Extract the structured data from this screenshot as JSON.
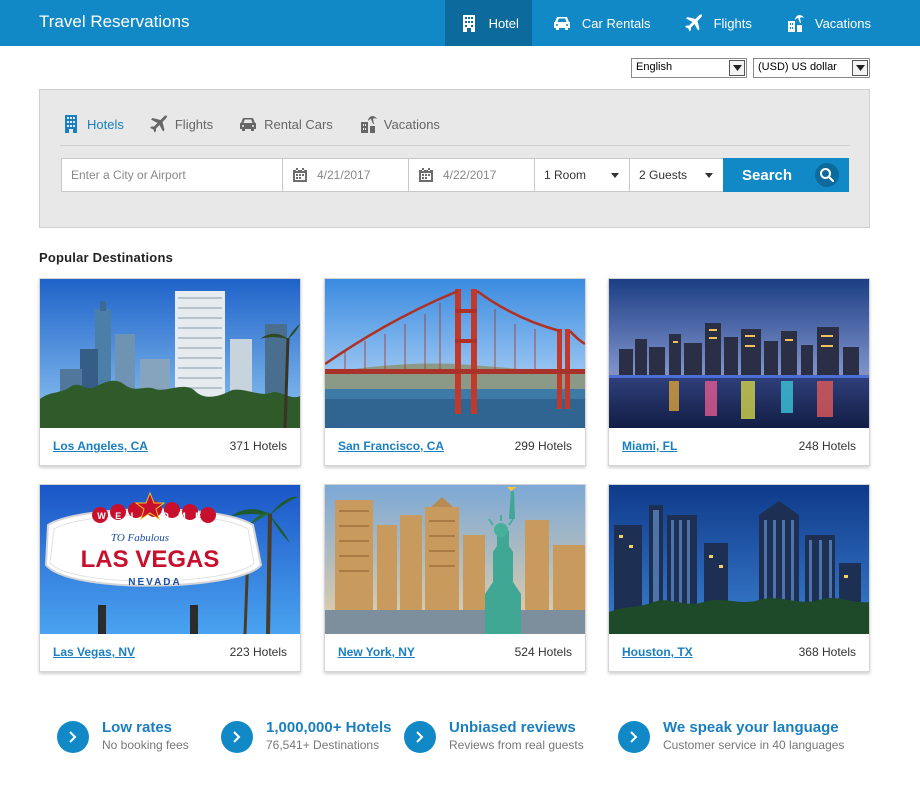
{
  "header": {
    "brand": "Travel Reservations",
    "nav": [
      {
        "label": "Hotel",
        "icon": "hotel-building-icon",
        "active": true
      },
      {
        "label": "Car Rentals",
        "icon": "car-icon",
        "active": false
      },
      {
        "label": "Flights",
        "icon": "airplane-icon",
        "active": false
      },
      {
        "label": "Vacations",
        "icon": "vacation-icon",
        "active": false
      }
    ]
  },
  "selects": {
    "language": "English",
    "currency": "(USD) US dollar"
  },
  "search": {
    "tabs": [
      {
        "label": "Hotels",
        "icon": "hotel-building-icon",
        "active": true
      },
      {
        "label": "Flights",
        "icon": "airplane-icon",
        "active": false
      },
      {
        "label": "Rental Cars",
        "icon": "car-icon",
        "active": false
      },
      {
        "label": "Vacations",
        "icon": "vacation-icon",
        "active": false
      }
    ],
    "destination_placeholder": "Enter a City or Airport",
    "checkin": "4/21/2017",
    "checkout": "4/22/2017",
    "rooms": "1 Room",
    "guests": "2 Guests",
    "button_label": "Search"
  },
  "popular": {
    "heading": "Popular Destinations",
    "destinations": [
      {
        "name": "Los Angeles, CA",
        "hotels": "371 Hotels"
      },
      {
        "name": "San Francisco, CA",
        "hotels": "299 Hotels"
      },
      {
        "name": "Miami, FL",
        "hotels": "248 Hotels"
      },
      {
        "name": "Las Vegas, NV",
        "hotels": "223 Hotels"
      },
      {
        "name": "New York, NY",
        "hotels": "524 Hotels"
      },
      {
        "name": "Houston, TX",
        "hotels": "368 Hotels"
      }
    ],
    "vegas_sign": {
      "welcome": "WELCOME",
      "to": "TO Fabulous",
      "main": "LAS VEGAS",
      "state": "NEVADA"
    }
  },
  "features": [
    {
      "title": "Low rates",
      "subtitle": "No booking fees"
    },
    {
      "title": "1,000,000+ Hotels",
      "subtitle": "76,541+ Destinations"
    },
    {
      "title": "Unbiased reviews",
      "subtitle": "Reviews from real guests"
    },
    {
      "title": "We speak your language",
      "subtitle": "Customer service in 40 languages"
    }
  ],
  "colors": {
    "brand_blue": "#1289c7",
    "active_nav": "#0c6a9d",
    "link_blue": "#1a7fc0",
    "panel_gray": "#e8e8e8"
  }
}
